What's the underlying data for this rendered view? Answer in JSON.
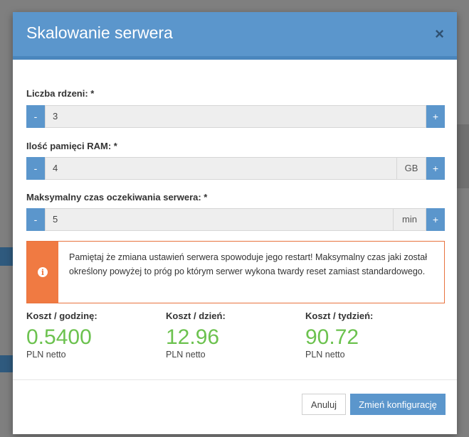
{
  "modal": {
    "title": "Skalowanie serwera",
    "close_symbol": "×",
    "fields": {
      "cores": {
        "label": "Liczba rdzeni: *",
        "value": "3",
        "minus": "-",
        "plus": "+"
      },
      "ram": {
        "label": "Ilość pamięci RAM: *",
        "value": "4",
        "unit": "GB",
        "minus": "-",
        "plus": "+"
      },
      "wait_time": {
        "label": "Maksymalny czas oczekiwania serwera: *",
        "value": "5",
        "unit": "min",
        "minus": "-",
        "plus": "+"
      }
    },
    "alert": {
      "icon": "info-icon",
      "text": "Pamiętaj że zmiana ustawień serwera spowoduje jego restart! Maksymalny czas jaki został określony powyżej to próg po którym serwer wykona twardy reset zamiast standardowego."
    },
    "costs": [
      {
        "label": "Koszt / godzinę:",
        "value": "0.5400",
        "unit": "PLN netto"
      },
      {
        "label": "Koszt / dzień:",
        "value": "12.96",
        "unit": "PLN netto"
      },
      {
        "label": "Koszt / tydzień:",
        "value": "90.72",
        "unit": "PLN netto"
      }
    ],
    "footer": {
      "cancel_label": "Anuluj",
      "submit_label": "Zmień konfigurację"
    }
  },
  "colors": {
    "header": "#5b96cc",
    "cost_value": "#6cc24f",
    "alert_accent": "#f07a42"
  }
}
